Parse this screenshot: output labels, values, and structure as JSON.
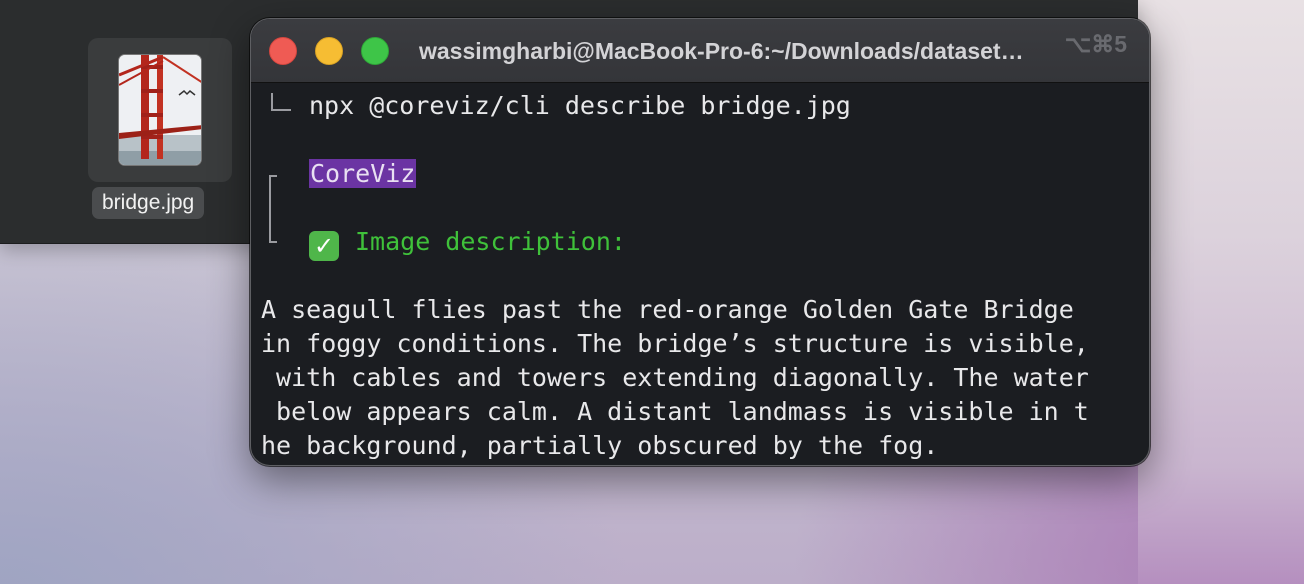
{
  "desktop_file": {
    "name": "bridge.jpg",
    "thumbnail_icon": "golden-gate-bridge-thumbnail"
  },
  "terminal": {
    "title": "wassimgharbi@MacBook-Pro-6:~/Downloads/dataset…",
    "shortcut": "⌥⌘5",
    "command": "npx @coreviz/cli describe bridge.jpg",
    "brand": "CoreViz",
    "status_icon": "check-mark-icon",
    "status_text": "Image description:",
    "description_lines": [
      "A seagull flies past the red-orange Golden Gate Bridge",
      "in foggy conditions. The bridge’s structure is visible,",
      " with cables and towers extending diagonally. The water",
      " below appears calm. A distant landmass is visible in t",
      "he background, partially obscured by the fog."
    ],
    "colors": {
      "brand_highlight": "#6b34a3",
      "success_green": "#3fc13a",
      "close": "#ef5b54",
      "minimize": "#f6bd33",
      "maximize": "#3ec548"
    }
  }
}
